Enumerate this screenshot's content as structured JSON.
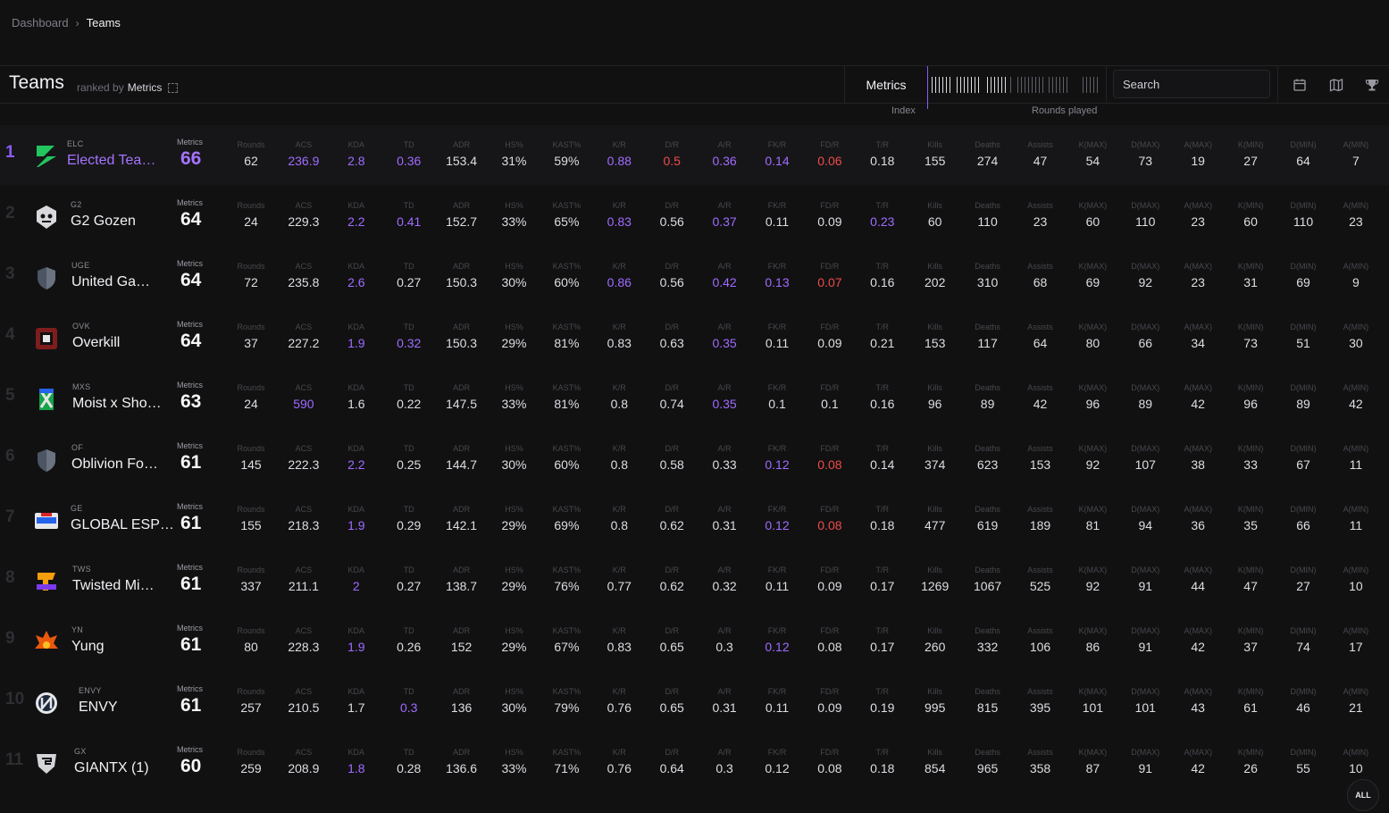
{
  "breadcrumb": {
    "root": "Dashboard",
    "current": "Teams"
  },
  "header": {
    "title": "Teams",
    "ranked_by": "ranked by",
    "metric": "Metrics",
    "metrics_tab": "Metrics",
    "index_label": "Index",
    "rounds_played_label": "Rounds played",
    "search_placeholder": "Search",
    "tool_icons": [
      "calendar-icon",
      "map-icon",
      "trophy-icon"
    ]
  },
  "colors": {
    "accent": "#a673ff",
    "negative": "#ef4b4b",
    "background": "#111112"
  },
  "columns": [
    "Rounds",
    "ACS",
    "KDA",
    "TD",
    "ADR",
    "HS%",
    "KAST%",
    "K/R",
    "D/R",
    "A/R",
    "FK/R",
    "FD/R",
    "T/R",
    "Kills",
    "Deaths",
    "Assists",
    "K(MAX)",
    "D(MAX)",
    "A(MAX)",
    "K(MIN)",
    "D(MIN)",
    "A(MIN)"
  ],
  "metric_label": "Metrics",
  "teams": [
    {
      "rank": "1",
      "abbr": "ELC",
      "name": "Elected Tea…",
      "metric": "66",
      "values": [
        "62",
        "236.9",
        "2.8",
        "0.36",
        "153.4",
        "31%",
        "59%",
        "0.88",
        "0.5",
        "0.36",
        "0.14",
        "0.06",
        "0.18",
        "155",
        "274",
        "47",
        "54",
        "73",
        "19",
        "27",
        "64",
        "7"
      ],
      "hl": [
        1,
        2,
        3,
        7,
        9,
        10
      ],
      "neg": [
        8,
        11
      ]
    },
    {
      "rank": "2",
      "abbr": "G2",
      "name": "G2 Gozen",
      "metric": "64",
      "values": [
        "24",
        "229.3",
        "2.2",
        "0.41",
        "152.7",
        "33%",
        "65%",
        "0.83",
        "0.56",
        "0.37",
        "0.11",
        "0.09",
        "0.23",
        "60",
        "110",
        "23",
        "60",
        "110",
        "23",
        "60",
        "110",
        "23"
      ],
      "hl": [
        2,
        3,
        7,
        9,
        12
      ],
      "neg": []
    },
    {
      "rank": "3",
      "abbr": "UGE",
      "name": "United Ga…",
      "metric": "64",
      "values": [
        "72",
        "235.8",
        "2.6",
        "0.27",
        "150.3",
        "30%",
        "60%",
        "0.86",
        "0.56",
        "0.42",
        "0.13",
        "0.07",
        "0.16",
        "202",
        "310",
        "68",
        "69",
        "92",
        "23",
        "31",
        "69",
        "9"
      ],
      "hl": [
        2,
        7,
        9,
        10
      ],
      "neg": [
        11
      ]
    },
    {
      "rank": "4",
      "abbr": "OVK",
      "name": "Overkill",
      "metric": "64",
      "values": [
        "37",
        "227.2",
        "1.9",
        "0.32",
        "150.3",
        "29%",
        "81%",
        "0.83",
        "0.63",
        "0.35",
        "0.11",
        "0.09",
        "0.21",
        "153",
        "117",
        "64",
        "80",
        "66",
        "34",
        "73",
        "51",
        "30"
      ],
      "hl": [
        2,
        3,
        9
      ],
      "neg": []
    },
    {
      "rank": "5",
      "abbr": "MXS",
      "name": "Moist x Sho…",
      "metric": "63",
      "values": [
        "24",
        "590",
        "1.6",
        "0.22",
        "147.5",
        "33%",
        "81%",
        "0.8",
        "0.74",
        "0.35",
        "0.1",
        "0.1",
        "0.16",
        "96",
        "89",
        "42",
        "96",
        "89",
        "42",
        "96",
        "89",
        "42"
      ],
      "hl": [
        1,
        9
      ],
      "neg": []
    },
    {
      "rank": "6",
      "abbr": "OF",
      "name": "Oblivion Fo…",
      "metric": "61",
      "values": [
        "145",
        "222.3",
        "2.2",
        "0.25",
        "144.7",
        "30%",
        "60%",
        "0.8",
        "0.58",
        "0.33",
        "0.12",
        "0.08",
        "0.14",
        "374",
        "623",
        "153",
        "92",
        "107",
        "38",
        "33",
        "67",
        "11"
      ],
      "hl": [
        2,
        10
      ],
      "neg": [
        11
      ]
    },
    {
      "rank": "7",
      "abbr": "GE",
      "name": "GLOBAL ESP…",
      "metric": "61",
      "values": [
        "155",
        "218.3",
        "1.9",
        "0.29",
        "142.1",
        "29%",
        "69%",
        "0.8",
        "0.62",
        "0.31",
        "0.12",
        "0.08",
        "0.18",
        "477",
        "619",
        "189",
        "81",
        "94",
        "36",
        "35",
        "66",
        "11"
      ],
      "hl": [
        2,
        10
      ],
      "neg": [
        11
      ]
    },
    {
      "rank": "8",
      "abbr": "TWS",
      "name": "Twisted Mi…",
      "metric": "61",
      "values": [
        "337",
        "211.1",
        "2",
        "0.27",
        "138.7",
        "29%",
        "76%",
        "0.77",
        "0.62",
        "0.32",
        "0.11",
        "0.09",
        "0.17",
        "1269",
        "1067",
        "525",
        "92",
        "91",
        "44",
        "47",
        "27",
        "10"
      ],
      "hl": [
        2
      ],
      "neg": []
    },
    {
      "rank": "9",
      "abbr": "YN",
      "name": "Yung",
      "metric": "61",
      "values": [
        "80",
        "228.3",
        "1.9",
        "0.26",
        "152",
        "29%",
        "67%",
        "0.83",
        "0.65",
        "0.3",
        "0.12",
        "0.08",
        "0.17",
        "260",
        "332",
        "106",
        "86",
        "91",
        "42",
        "37",
        "74",
        "17"
      ],
      "hl": [
        2,
        10
      ],
      "neg": []
    },
    {
      "rank": "10",
      "abbr": "ENVY",
      "name": "ENVY",
      "metric": "61",
      "values": [
        "257",
        "210.5",
        "1.7",
        "0.3",
        "136",
        "30%",
        "79%",
        "0.76",
        "0.65",
        "0.31",
        "0.11",
        "0.09",
        "0.19",
        "995",
        "815",
        "395",
        "101",
        "101",
        "43",
        "61",
        "46",
        "21"
      ],
      "hl": [
        3
      ],
      "neg": []
    },
    {
      "rank": "11",
      "abbr": "GX",
      "name": "GIANTX (1)",
      "metric": "60",
      "values": [
        "259",
        "208.9",
        "1.8",
        "0.28",
        "136.6",
        "33%",
        "71%",
        "0.76",
        "0.64",
        "0.3",
        "0.12",
        "0.08",
        "0.18",
        "854",
        "965",
        "358",
        "87",
        "91",
        "42",
        "26",
        "55",
        "10"
      ],
      "hl": [
        2
      ],
      "neg": []
    }
  ],
  "all_button": "ALL"
}
